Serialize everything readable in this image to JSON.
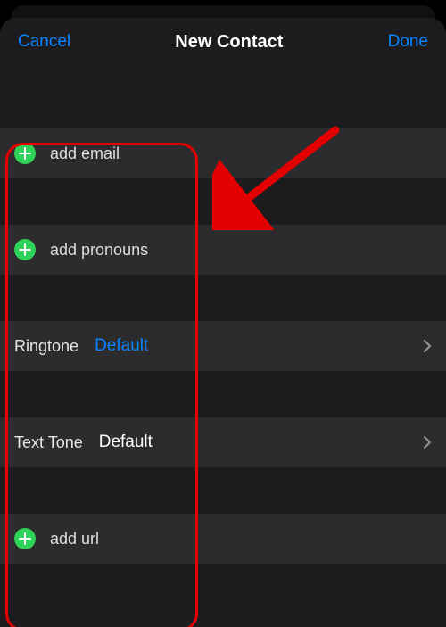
{
  "nav": {
    "cancel": "Cancel",
    "title": "New Contact",
    "done": "Done"
  },
  "rows": {
    "add_email": "add email",
    "add_pronouns": "add pronouns",
    "ringtone_label": "Ringtone",
    "ringtone_value": "Default",
    "texttone_label": "Text Tone",
    "texttone_value": "Default",
    "add_url": "add url"
  }
}
